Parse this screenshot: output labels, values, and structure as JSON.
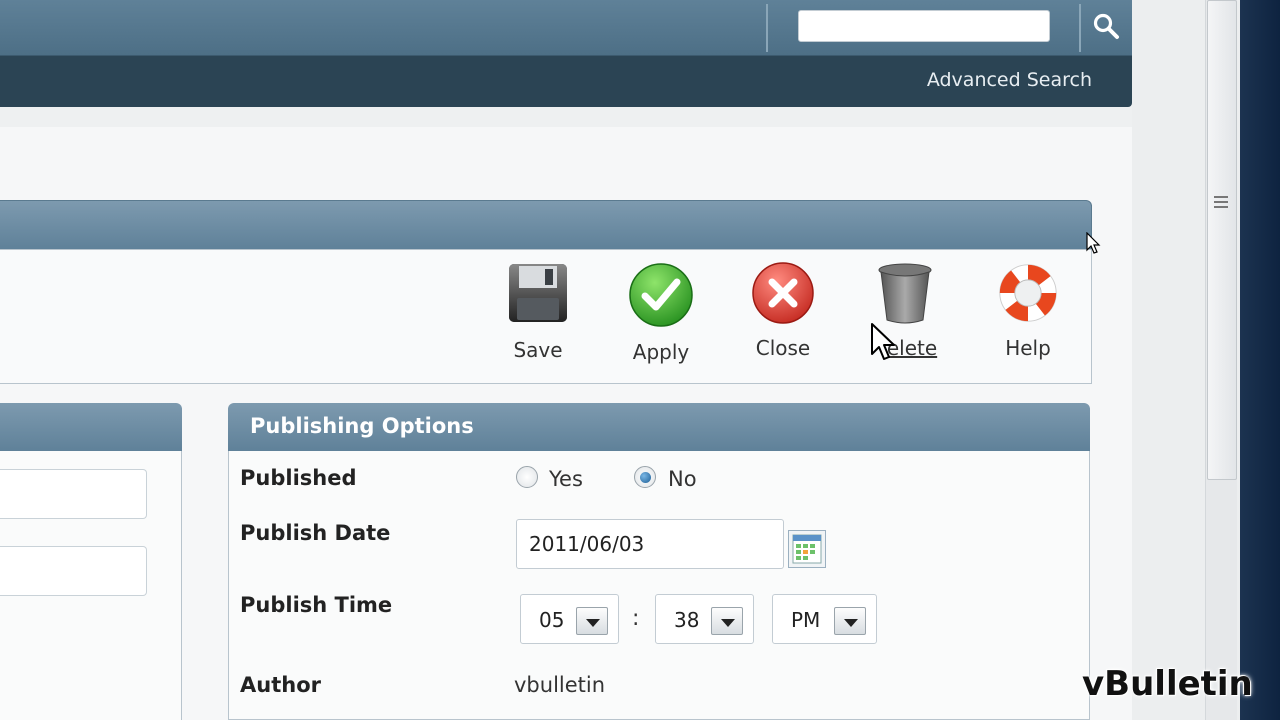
{
  "search": {
    "value": "",
    "advanced_label": "Advanced Search"
  },
  "toolbar": {
    "save_label": "Save",
    "apply_label": "Apply",
    "close_label": "Close",
    "delete_label": "elete",
    "help_label": "Help"
  },
  "publishing": {
    "title": "Publishing Options",
    "published_label": "Published",
    "yes_label": "Yes",
    "no_label": "No",
    "published_value": "No",
    "publish_date_label": "Publish Date",
    "publish_date_value": "2011/06/03",
    "publish_time_label": "Publish Time",
    "hour": "05",
    "minute": "38",
    "ampm": "PM",
    "colon": ":",
    "author_label": "Author",
    "author_value": "vbulletin"
  },
  "watermark": "vBulletin",
  "colors": {
    "header_blue": "#5f8199",
    "nav_dark": "#2b4454"
  }
}
